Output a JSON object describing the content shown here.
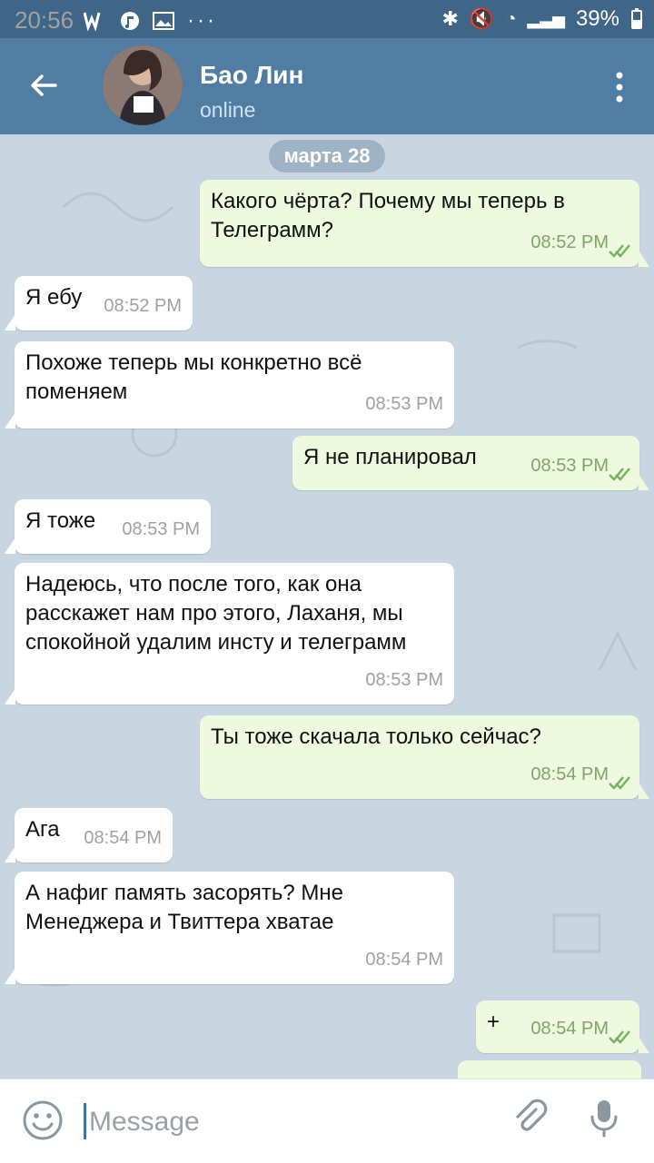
{
  "status": {
    "time": "20:56",
    "battery": "39%"
  },
  "header": {
    "name": "Бао Лин",
    "status": "online"
  },
  "chat": {
    "date": "марта 28",
    "messages": [
      {
        "direction": "outgoing",
        "text": "Какого чёрта? Почему мы теперь в Телеграмм?",
        "time": "08:52 PM"
      },
      {
        "direction": "incoming",
        "text": "Я ебу",
        "time": "08:52 PM"
      },
      {
        "direction": "incoming",
        "text": "Похоже теперь мы конкретно всё поменяем",
        "time": "08:53 PM"
      },
      {
        "direction": "outgoing",
        "text": "Я не планировал",
        "time": "08:53 PM"
      },
      {
        "direction": "incoming",
        "text": "Я тоже",
        "time": "08:53 PM"
      },
      {
        "direction": "incoming",
        "text": "Надеюсь, что после того, как она расскажет нам про этого, Лаханя, мы спокойной удалим инсту и телеграмм",
        "time": "08:53 PM"
      },
      {
        "direction": "outgoing",
        "text": "Ты тоже скачала только сейчас?",
        "time": "08:54 PM"
      },
      {
        "direction": "incoming",
        "text": "Ага",
        "time": "08:54 PM"
      },
      {
        "direction": "incoming",
        "text": "А нафиг память засорять? Мне Менеджера и Твиттера хватае",
        "time": "08:54 PM"
      },
      {
        "direction": "outgoing",
        "text": "+",
        "time": "08:54 PM"
      }
    ]
  },
  "composer": {
    "placeholder": "Message"
  },
  "icons": {
    "back": "arrow-left-icon",
    "menu": "more-vert-icon",
    "emoji": "emoji-icon",
    "attach": "paperclip-icon",
    "mic": "microphone-icon",
    "read": "double-check-icon"
  },
  "colors": {
    "statusbar": "#3f6587",
    "header": "#517da2",
    "chat_bg": "#c9d6e1",
    "incoming": "#ffffff",
    "outgoing": "#eff9df"
  }
}
